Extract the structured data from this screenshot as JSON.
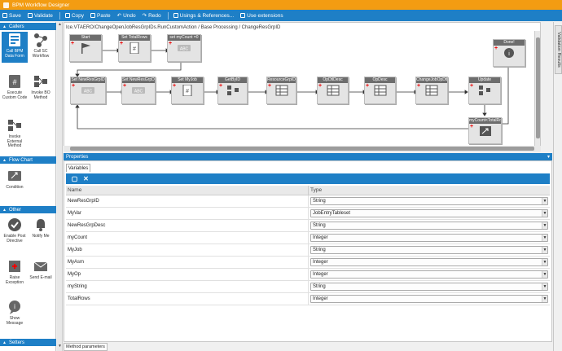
{
  "window": {
    "title": "BPM Workflow Designer"
  },
  "toolbar": {
    "save": "Save",
    "validate": "Validate",
    "copy": "Copy",
    "paste": "Paste",
    "undo": "Undo",
    "redo": "Redo",
    "usings": "Usings & References...",
    "extensions": "Use extensions"
  },
  "left_panel": {
    "callers_header": "Callers",
    "callers": [
      "Call BPM Data Form",
      "Call SC Workflow",
      "Execute Custom Code",
      "Invoke BO Method",
      "Invoke External Method"
    ],
    "flow_header": "Flow Chart",
    "flow": [
      "Condition"
    ],
    "other_header": "Other",
    "other": [
      "Enable Post Directive",
      "Notify Me",
      "Raise Exception",
      "Send E-mail",
      "Show Message"
    ],
    "setters_header": "Setters"
  },
  "designer": {
    "breadcrumb": "Ice.VTAERO/ChangeOpenJobResGrpIDs.RunCustomAction / Base Processing / ChangeResGrpID",
    "nodes": [
      "Start",
      "Set TotalRows",
      "set myCount =0",
      "Done!",
      "Set NewResGrpID",
      "Set NewResGrpDes",
      "Set MyJob",
      "GetByID",
      "ResourceGrpID",
      "OpDtlDesc",
      "OpDesc",
      "ChangeJobOpDtlR",
      "Update",
      "myCount<TotalRo"
    ],
    "node_tag": "ABC"
  },
  "properties": {
    "header": "Properties",
    "tab": "Variables",
    "columns": {
      "name": "Name",
      "type": "Type"
    },
    "variables": [
      {
        "name": "NewResGrpID",
        "type": "String"
      },
      {
        "name": "MyVar",
        "type": "JobEntryTableset"
      },
      {
        "name": "NewResGrpDesc",
        "type": "String"
      },
      {
        "name": "myCount",
        "type": "Integer"
      },
      {
        "name": "MyJob",
        "type": "String"
      },
      {
        "name": "MyAsm",
        "type": "Integer"
      },
      {
        "name": "MyOp",
        "type": "Integer"
      },
      {
        "name": "myString",
        "type": "String"
      },
      {
        "name": "TotalRows",
        "type": "Integer"
      }
    ]
  },
  "bottom_tab": "Method parameters",
  "right_panel": {
    "validation": "Validation Results"
  },
  "colors": {
    "accent": "#1e7fc6",
    "title_bar": "#f39c12",
    "node_header": "#6d6d6d"
  }
}
